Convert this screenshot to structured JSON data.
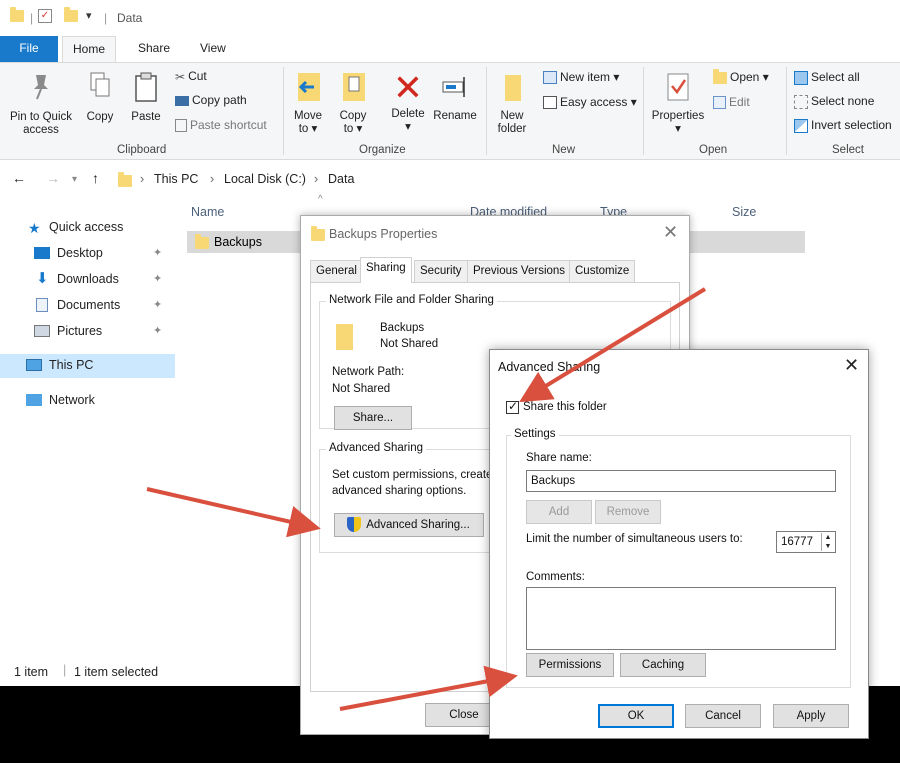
{
  "window": {
    "title": "Data"
  },
  "ribbon_tabs": [
    "File",
    "Home",
    "Share",
    "View"
  ],
  "ribbon": {
    "clipboard": {
      "label": "Clipboard",
      "pin_line1": "Pin to Quick",
      "pin_line2": "access",
      "copy": "Copy",
      "paste": "Paste",
      "cut": "Cut",
      "copy_path": "Copy path",
      "paste_shortcut": "Paste shortcut"
    },
    "organize": {
      "label": "Organize",
      "move_to_line1": "Move",
      "move_to_line2": "to ▾",
      "copy_to_line1": "Copy",
      "copy_to_line2": "to ▾",
      "delete": "Delete",
      "delete_arrow": "▾",
      "rename": "Rename"
    },
    "new": {
      "label": "New",
      "new_folder_line1": "New",
      "new_folder_line2": "folder",
      "new_item": "New item ▾",
      "easy_access": "Easy access ▾"
    },
    "open": {
      "label": "Open",
      "properties": "Properties",
      "properties_arrow": "▾",
      "open": "Open ▾",
      "edit": "Edit"
    },
    "select": {
      "label": "Select",
      "select_all": "Select all",
      "select_none": "Select none",
      "invert_selection": "Invert selection"
    }
  },
  "address": {
    "crumbs": [
      "This PC",
      "Local Disk (C:)",
      "Data"
    ],
    "separator": "›"
  },
  "nav": {
    "quick_access": "Quick access",
    "items": [
      "Desktop",
      "Downloads",
      "Documents",
      "Pictures"
    ],
    "this_pc": "This PC",
    "network": "Network"
  },
  "file_list": {
    "columns": {
      "name": "Name",
      "date_modified": "Date modified",
      "type": "Type",
      "size": "Size"
    },
    "rows": [
      {
        "name": "Backups"
      }
    ]
  },
  "status": {
    "count": "1 item",
    "selected": "1 item selected"
  },
  "properties_dialog": {
    "title": "Backups Properties",
    "tabs": [
      "General",
      "Sharing",
      "Security",
      "Previous Versions",
      "Customize"
    ],
    "network_group": "Network File and Folder Sharing",
    "folder_name": "Backups",
    "share_state": "Not Shared",
    "network_path_label": "Network Path:",
    "network_path_value": "Not Shared",
    "share_button": "Share...",
    "advanced_group": "Advanced Sharing",
    "advanced_desc_line1": "Set custom permissions, create",
    "advanced_desc_line2": "advanced sharing options.",
    "advanced_button": "Advanced Sharing...",
    "close_button": "Close"
  },
  "advanced_dialog": {
    "title": "Advanced Sharing",
    "share_checkbox_label": "Share this folder",
    "share_checked": true,
    "settings_group": "Settings",
    "share_name_label": "Share name:",
    "share_name_value": "Backups",
    "add_button": "Add",
    "remove_button": "Remove",
    "limit_label": "Limit the number of simultaneous users to:",
    "limit_value": "16777",
    "comments_label": "Comments:",
    "permissions_button": "Permissions",
    "caching_button": "Caching",
    "ok_button": "OK",
    "cancel_button": "Cancel",
    "apply_button": "Apply"
  },
  "colors": {
    "accent": "#1979ca",
    "selection": "#cce8ff",
    "arrow": "#d9503f",
    "folder": "#f8d775"
  }
}
